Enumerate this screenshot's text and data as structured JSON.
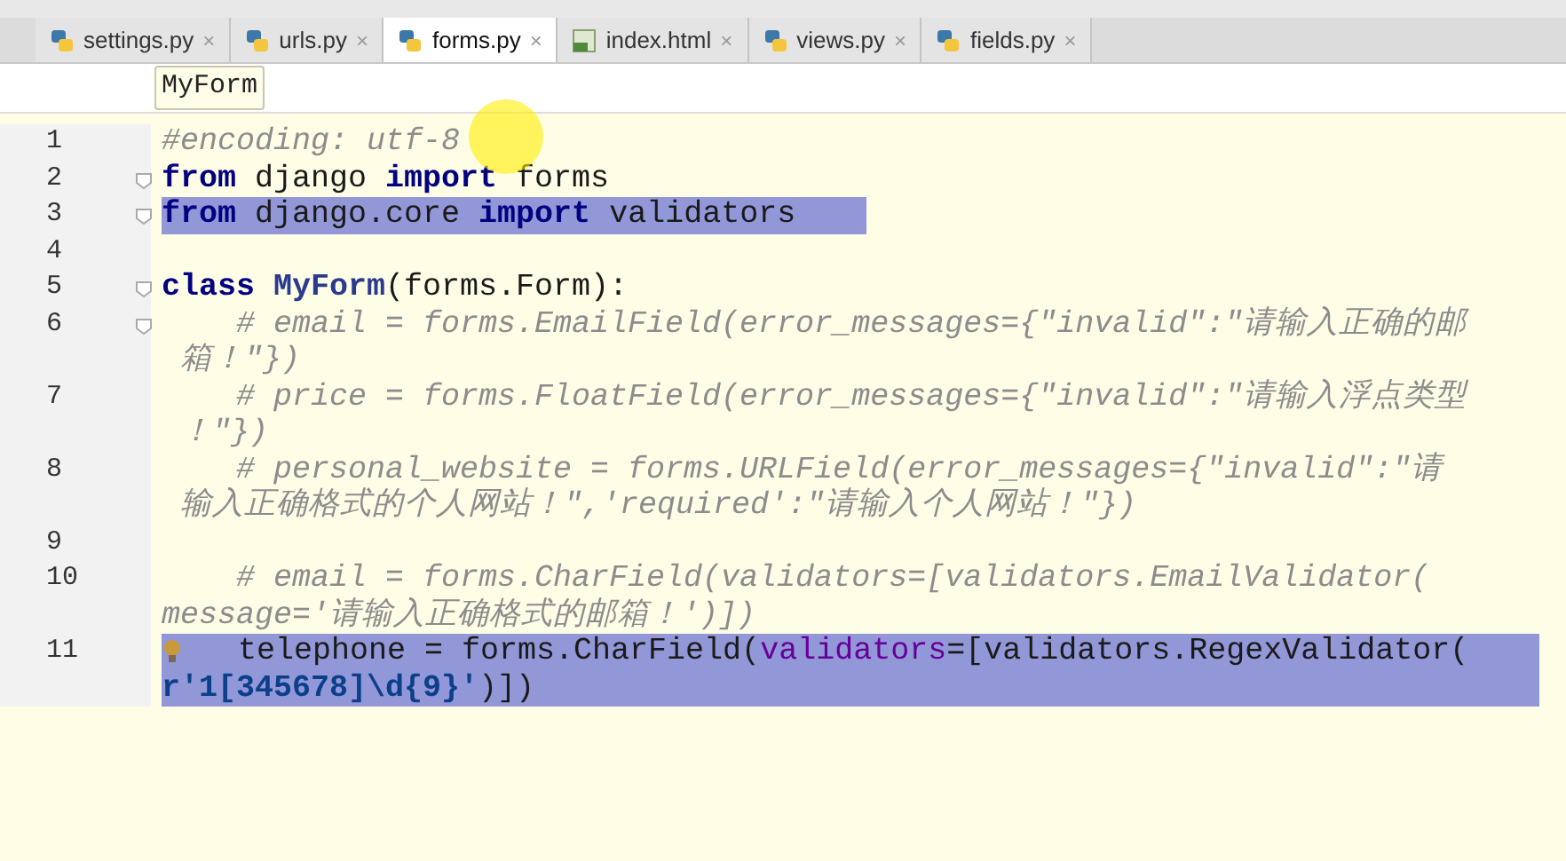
{
  "tabs": [
    {
      "label": "settings.py",
      "kind": "python",
      "selected": false,
      "close": "×"
    },
    {
      "label": "urls.py",
      "kind": "python",
      "selected": false,
      "close": "×"
    },
    {
      "label": "forms.py",
      "kind": "python",
      "selected": true,
      "close": "×"
    },
    {
      "label": "index.html",
      "kind": "html",
      "selected": false,
      "close": "×"
    },
    {
      "label": "views.py",
      "kind": "python",
      "selected": false,
      "close": "×"
    },
    {
      "label": "fields.py",
      "kind": "python",
      "selected": false,
      "close": "×"
    }
  ],
  "breadcrumb": "MyForm",
  "lines": [
    {
      "number": "1",
      "selected": false,
      "fold": false,
      "wrapped": [
        {
          "segments": [
            {
              "kind": "comment",
              "text": "#encoding: utf-8"
            }
          ]
        }
      ]
    },
    {
      "number": "2",
      "selected": false,
      "fold": true,
      "wrapped": [
        {
          "segments": [
            {
              "kind": "keyword",
              "text": "from"
            },
            {
              "kind": "plain",
              "text": " django "
            },
            {
              "kind": "keyword",
              "text": "import"
            },
            {
              "kind": "plain",
              "text": " forms"
            }
          ]
        }
      ]
    },
    {
      "number": "3",
      "selected": true,
      "fold": true,
      "wrapped": [
        {
          "segments": [
            {
              "kind": "keyword",
              "text": "from"
            },
            {
              "kind": "plain",
              "text": " django.core "
            },
            {
              "kind": "keyword",
              "text": "import"
            },
            {
              "kind": "plain",
              "text": " validators"
            }
          ]
        }
      ]
    },
    {
      "number": "4",
      "selected": false,
      "fold": false
    },
    {
      "number": "5",
      "selected": false,
      "fold": true,
      "wrapped": [
        {
          "segments": [
            {
              "kind": "keyword",
              "text": "class"
            },
            {
              "kind": "classname",
              "text": " MyForm"
            },
            {
              "kind": "plain",
              "text": "(forms.Form):"
            }
          ]
        }
      ]
    },
    {
      "number": "6",
      "selected": false,
      "fold": true,
      "wrapped": [
        {
          "segments": [
            {
              "kind": "comment",
              "text": "    # email = forms.EmailField(error_messages={\"invalid\":\"请输入正确的邮"
            }
          ]
        },
        {
          "segments": [
            {
              "kind": "comment",
              "text": " 箱！\"})"
            }
          ]
        }
      ]
    },
    {
      "number": "7",
      "selected": false,
      "fold": false,
      "wrapped": [
        {
          "segments": [
            {
              "kind": "comment",
              "text": "    # price = forms.FloatField(error_messages={\"invalid\":\"请输入浮点类型"
            }
          ]
        },
        {
          "segments": [
            {
              "kind": "comment",
              "text": " ！\"})"
            }
          ]
        }
      ]
    },
    {
      "number": "8",
      "selected": false,
      "fold": false,
      "wrapped": [
        {
          "segments": [
            {
              "kind": "comment",
              "text": "    # personal_website = forms.URLField(error_messages={\"invalid\":\"请"
            }
          ]
        },
        {
          "segments": [
            {
              "kind": "comment",
              "text": " 输入正确格式的个人网站！\",'required':\"请输入个人网站！\"})"
            }
          ]
        }
      ]
    },
    {
      "number": "9",
      "selected": false,
      "fold": false
    },
    {
      "number": "10",
      "selected": false,
      "fold": false,
      "wrapped": [
        {
          "segments": [
            {
              "kind": "comment",
              "text": "    # email = forms.CharField(validators=[validators.EmailValidator("
            }
          ]
        },
        {
          "segments": [
            {
              "kind": "comment",
              "text": "message='请输入正确格式的邮箱！')])"
            }
          ]
        }
      ]
    },
    {
      "number": "11",
      "selected": true,
      "fold": false,
      "wrapped": [
        {
          "segments": [
            {
              "kind": "bulb"
            },
            {
              "kind": "plain",
              "text": "  telephone = forms.CharField("
            },
            {
              "kind": "param",
              "text": "validators"
            },
            {
              "kind": "plain",
              "text": "=[validators.RegexValidator("
            }
          ]
        },
        {
          "segments": [
            {
              "kind": "string",
              "text": "r'1[345678]\\d{9}'"
            },
            {
              "kind": "plain",
              "text": ")])"
            }
          ]
        }
      ]
    }
  ]
}
